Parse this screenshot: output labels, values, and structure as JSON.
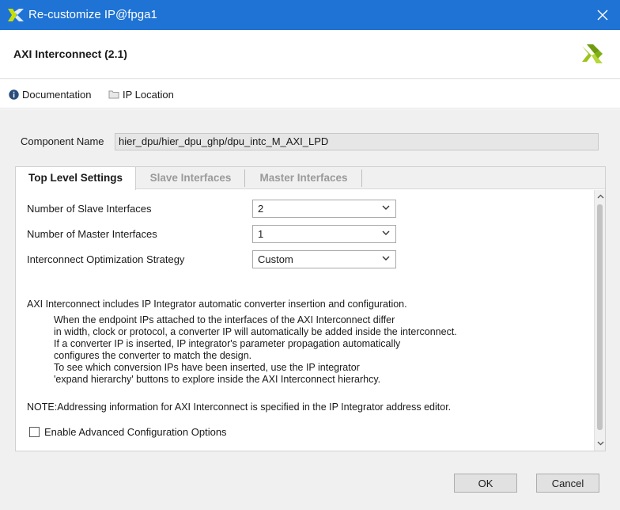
{
  "window": {
    "title": "Re-customize IP@fpga1",
    "app_icon": "xilinx-logo-icon",
    "close_icon": "close-icon",
    "titlebar_color": "#1f73d4"
  },
  "header": {
    "ip_name": "AXI Interconnect (2.1)",
    "logo": "xilinx-logo-icon",
    "brand_color": "#8cb40a"
  },
  "links": {
    "documentation": "Documentation",
    "ip_location": "IP Location",
    "documentation_icon": "info-icon",
    "ip_location_icon": "folder-icon"
  },
  "component": {
    "label": "Component Name",
    "value": "hier_dpu/hier_dpu_ghp/dpu_intc_M_AXI_LPD"
  },
  "tabs": [
    {
      "label": "Top Level Settings",
      "active": true
    },
    {
      "label": "Slave Interfaces",
      "active": false
    },
    {
      "label": "Master Interfaces",
      "active": false
    }
  ],
  "settings": {
    "slave_label": "Number of Slave Interfaces",
    "slave_value": "2",
    "master_label": "Number of Master Interfaces",
    "master_value": "1",
    "strategy_label": "Interconnect Optimization Strategy",
    "strategy_value": "Custom"
  },
  "description": {
    "intro": "AXI Interconnect includes IP Integrator automatic converter insertion and configuration.",
    "lines": [
      "When the endpoint IPs attached to the interfaces of the AXI Interconnect differ",
      "in width, clock or protocol, a converter IP will automatically be added inside the interconnect.",
      "If a converter IP is inserted, IP integrator's parameter propagation automatically",
      "configures the converter to match the design.",
      "To see which conversion IPs have been inserted, use the IP integrator",
      "'expand hierarchy' buttons to explore inside the AXI Interconnect hierarhcy."
    ],
    "note": "NOTE:Addressing information for AXI Interconnect is specified in the IP Integrator address editor."
  },
  "advanced": {
    "label": "Enable Advanced Configuration Options",
    "checked": false
  },
  "buttons": {
    "ok": "OK",
    "cancel": "Cancel"
  }
}
